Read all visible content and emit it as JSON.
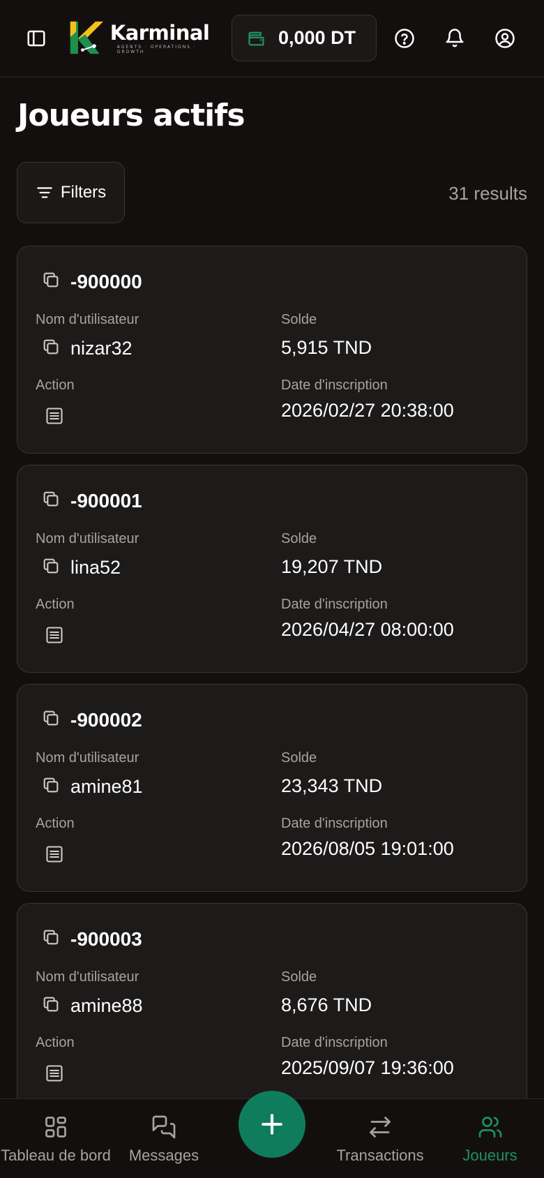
{
  "header": {
    "brand_name": "Karminal",
    "brand_tagline": "AGENTS · OPERATIONS · GROWTH",
    "balance": "0,000 DT",
    "icons": [
      "sidebar-icon",
      "wallet-icon",
      "help-icon",
      "bell-icon",
      "user-icon"
    ]
  },
  "page": {
    "title": "Joueurs actifs",
    "filters_label": "Filters",
    "results": "31 results"
  },
  "labels": {
    "username": "Nom d'utilisateur",
    "balance": "Solde",
    "action": "Action",
    "signup_date": "Date d'inscription"
  },
  "players": [
    {
      "id": "-900000",
      "username": "nizar32",
      "balance": "5,915 TND",
      "signup_date": "2026/02/27 20:38:00"
    },
    {
      "id": "-900001",
      "username": "lina52",
      "balance": "19,207 TND",
      "signup_date": "2026/04/27 08:00:00"
    },
    {
      "id": "-900002",
      "username": "amine81",
      "balance": "23,343 TND",
      "signup_date": "2026/08/05 19:01:00"
    },
    {
      "id": "-900003",
      "username": "amine88",
      "balance": "8,676 TND",
      "signup_date": "2025/09/07 19:36:00"
    }
  ],
  "nav": {
    "items": [
      {
        "label": "Tableau de bord",
        "icon": "grid-icon",
        "active": false
      },
      {
        "label": "Messages",
        "icon": "chat-icon",
        "active": false
      },
      {
        "label": "Transactions",
        "icon": "transfer-icon",
        "active": false
      },
      {
        "label": "Joueurs",
        "icon": "users-icon",
        "active": true
      }
    ],
    "fab_icon": "plus-icon"
  },
  "colors": {
    "background": "#140f0f",
    "card": "#1d1a1a",
    "accent": "#0f7d5b",
    "active_nav": "#1f8f66",
    "muted_text": "#a7a3a3"
  }
}
